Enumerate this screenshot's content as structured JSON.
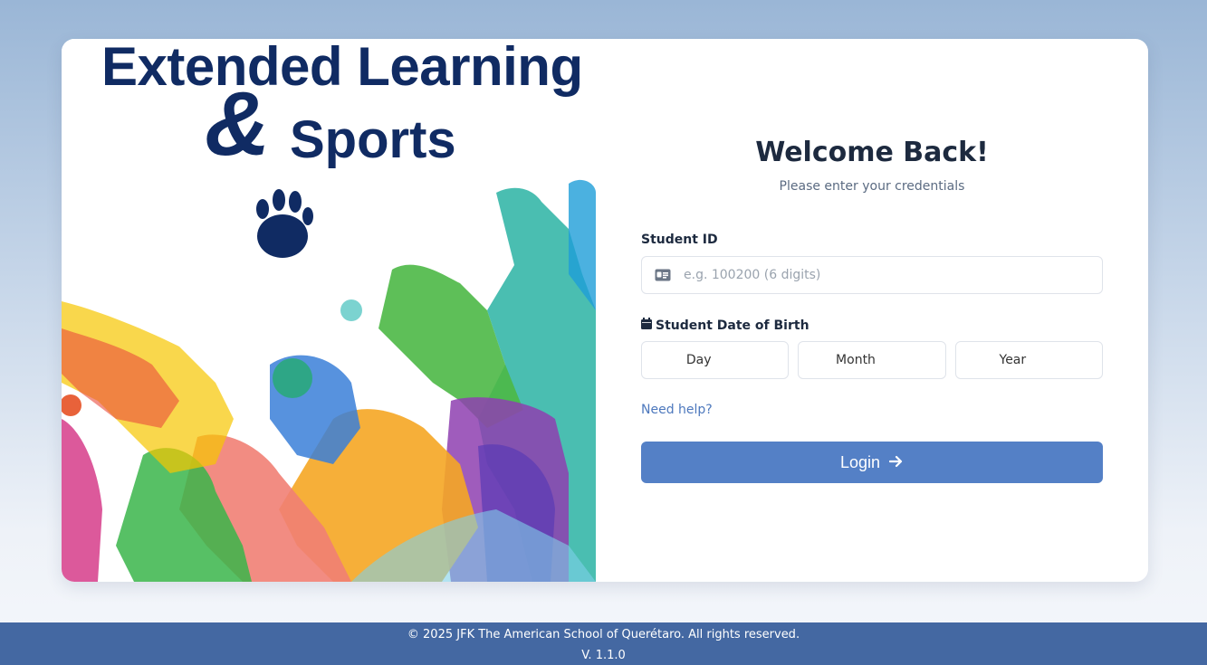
{
  "hero": {
    "title_line1": "Extended Learning",
    "ampersand": "&",
    "title_line2": "Sports"
  },
  "form": {
    "heading": "Welcome Back!",
    "subtitle": "Please enter your credentials",
    "student_id_label": "Student ID",
    "student_id_placeholder": "e.g. 100200 (6 digits)",
    "student_id_icon": "id-card-icon",
    "dob_label": "Student Date of Birth",
    "dob_icon": "calendar-icon",
    "day_label": "Day",
    "month_label": "Month",
    "year_label": "Year",
    "help_link": "Need help?",
    "login_label": "Login",
    "login_icon": "arrow-right-icon"
  },
  "footer": {
    "copyright": "© 2025 JFK The American School of Querétaro. All rights reserved.",
    "version": "V. 1.1.0"
  },
  "colors": {
    "brand_navy": "#102b63",
    "primary_button": "#5480c6",
    "footer_bg": "#4468a2",
    "link": "#4d78bd"
  }
}
